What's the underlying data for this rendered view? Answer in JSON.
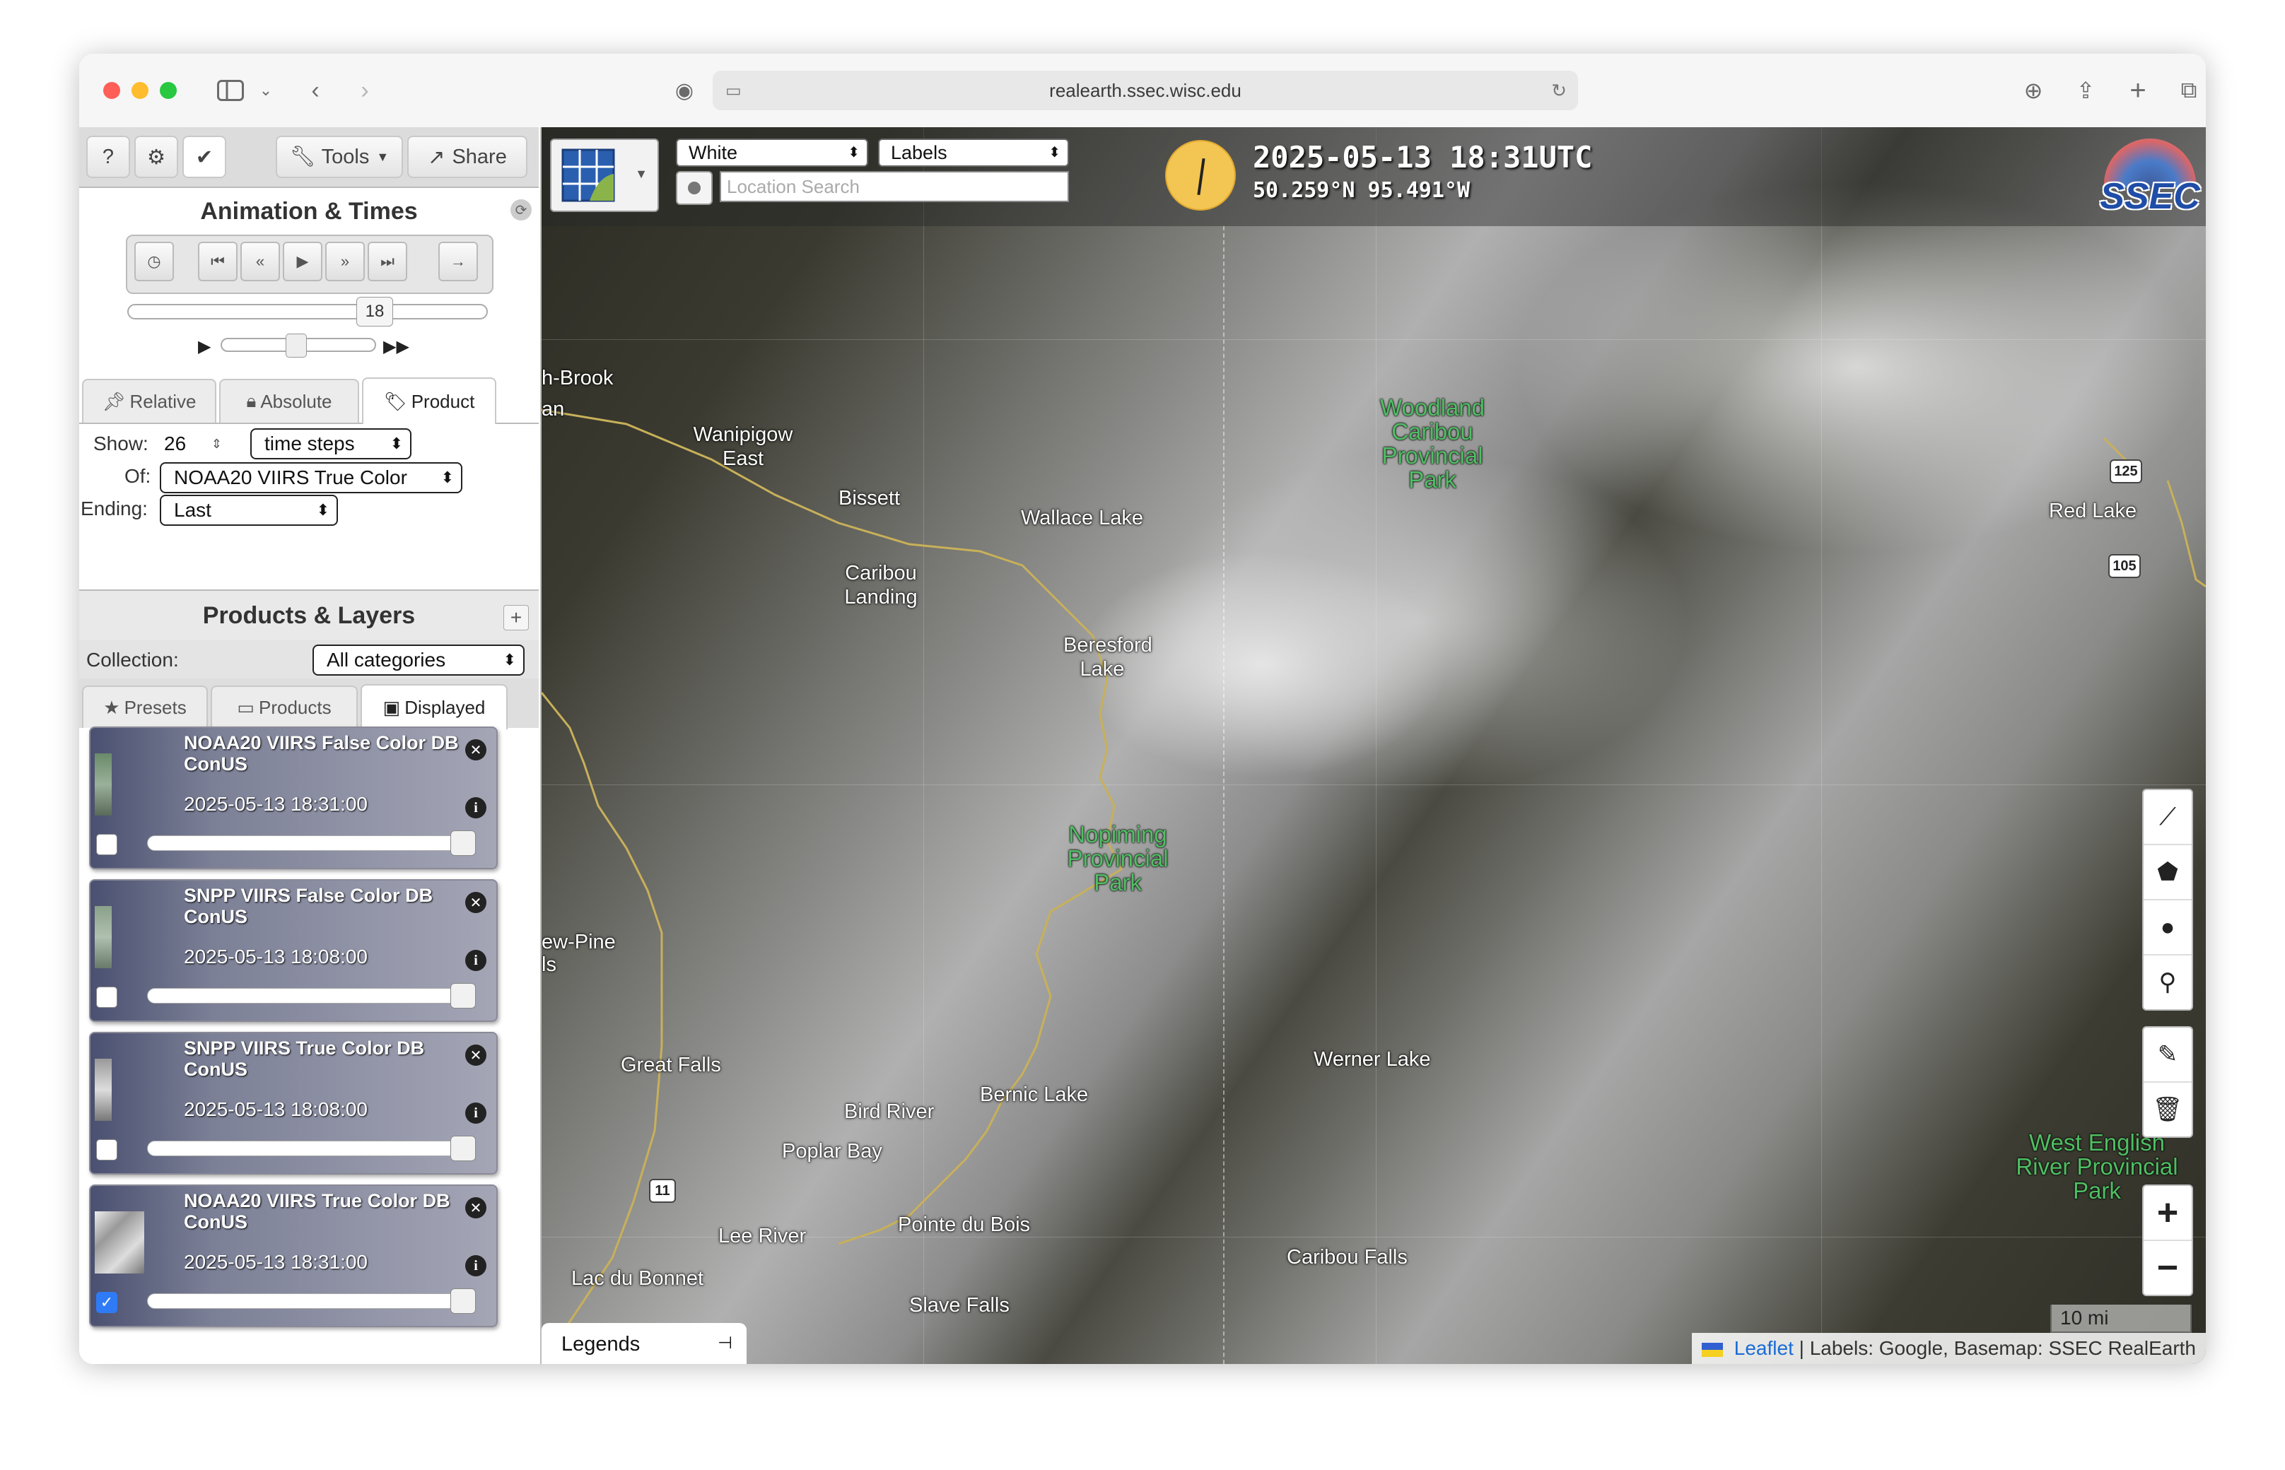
{
  "browser": {
    "url": "realearth.ssec.wisc.edu",
    "colors": {
      "close": "#ff5f57",
      "minimize": "#febc2e",
      "maximize": "#28c840"
    }
  },
  "panel": {
    "top_buttons": {
      "help": "?",
      "settings": "⚙",
      "check": "✔",
      "tools": "Tools",
      "share": "Share"
    },
    "animation_title": "Animation & Times",
    "frame_number": "18",
    "time_tabs": [
      "Relative",
      "Absolute",
      "Product"
    ],
    "show_label": "Show:",
    "show_value": "26",
    "show_unit": "time steps",
    "of_label": "Of:",
    "of_value": "NOAA20 VIIRS True Color",
    "ending_label": "Ending:",
    "ending_value": "Last",
    "products_title": "Products & Layers",
    "collection_label": "Collection:",
    "collection_value": "All categories",
    "layer_tabs": [
      "Presets",
      "Products",
      "Displayed"
    ],
    "layers": [
      {
        "title": "NOAA20 VIIRS False Color DB ConUS",
        "time": "2025-05-13 18:31:00",
        "checked": false
      },
      {
        "title": "SNPP VIIRS False Color DB ConUS",
        "time": "2025-05-13 18:08:00",
        "checked": false
      },
      {
        "title": "SNPP VIIRS True Color DB ConUS",
        "time": "2025-05-13 18:08:00",
        "checked": false
      },
      {
        "title": "NOAA20 VIIRS True Color DB ConUS",
        "time": "2025-05-13 18:31:00",
        "checked": true
      }
    ]
  },
  "map": {
    "basemap_select": "White",
    "labels_select": "Labels",
    "location_placeholder": "Location Search",
    "datetime": "2025-05-13 18:31UTC",
    "coords": "50.259°N 95.491°W",
    "logo": "SSEC",
    "scale": "10 mi",
    "legends": "Legends",
    "attribution_link": "Leaflet",
    "attribution_text": "| Labels: Google, Basemap: SSEC RealEarth",
    "zoom_in": "+",
    "zoom_out": "−",
    "places": {
      "brook": "h-Brook",
      "an": "an",
      "wanipigow": "Wanipigow East",
      "bissett": "Bissett",
      "wallace": "Wallace Lake",
      "caribou_landing": "Caribou Landing",
      "beresford": "Beresford Lake",
      "red_lake": "Red Lake",
      "pine": "ew-Pine",
      "ls": "ls",
      "great_falls": "Great Falls",
      "bird_river": "Bird River",
      "bernic": "Bernic Lake",
      "poplar": "Poplar Bay",
      "werner": "Werner Lake",
      "lee_river": "Lee River",
      "pointe": "Pointe du Bois",
      "lac": "Lac du Bonnet",
      "slave": "Slave Falls",
      "caribou_falls": "Caribou Falls"
    },
    "parks": {
      "woodland": "Woodland Caribou Provincial Park",
      "nopiming": "Nopiming Provincial Park",
      "west_english": "West English River Provincial Park"
    },
    "shields": {
      "h125": "125",
      "h105": "105",
      "h11": "11"
    }
  }
}
